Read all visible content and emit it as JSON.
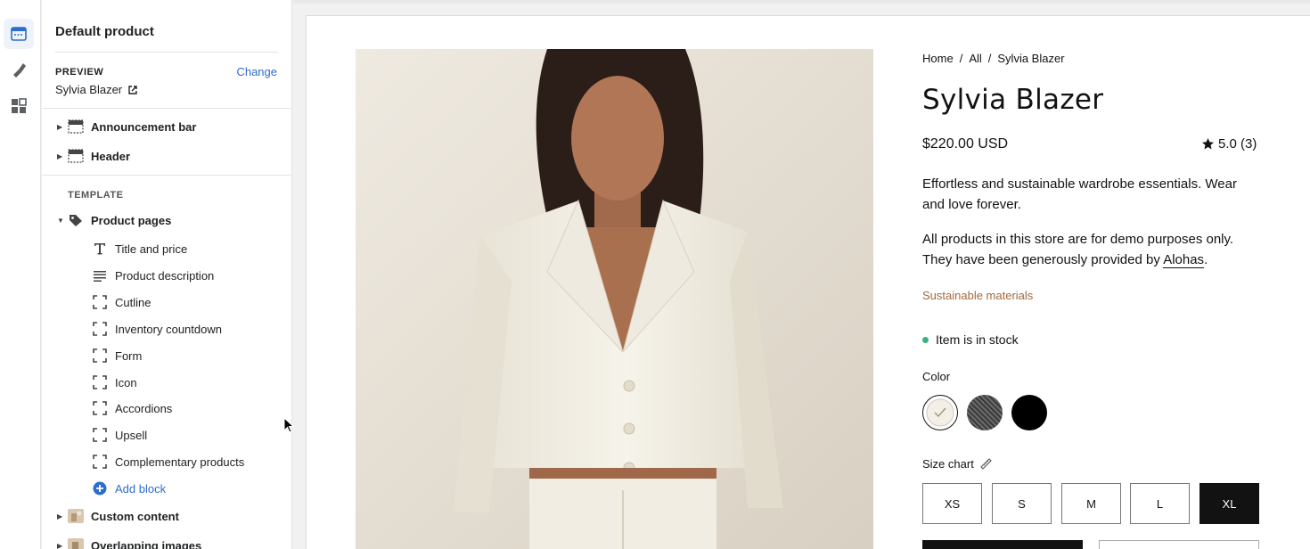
{
  "rail": {
    "items": [
      {
        "name": "sections",
        "active": true
      },
      {
        "name": "theme-settings",
        "active": false
      },
      {
        "name": "app-embeds",
        "active": false
      }
    ]
  },
  "sidebar": {
    "title": "Default product",
    "preview_label": "PREVIEW",
    "change_label": "Change",
    "preview_product": "Sylvia Blazer",
    "header_sections": [
      {
        "label": "Announcement bar",
        "icon": "section-icon"
      },
      {
        "label": "Header",
        "icon": "section-icon"
      }
    ],
    "template_label": "TEMPLATE",
    "product_pages_label": "Product pages",
    "blocks": [
      {
        "label": "Title and price",
        "icon": "text-icon"
      },
      {
        "label": "Product description",
        "icon": "paragraph-icon"
      },
      {
        "label": "Cutline",
        "icon": "app-block-icon"
      },
      {
        "label": "Inventory countdown",
        "icon": "app-block-icon"
      },
      {
        "label": "Form",
        "icon": "app-block-icon"
      },
      {
        "label": "Icon",
        "icon": "app-block-icon"
      },
      {
        "label": "Accordions",
        "icon": "app-block-icon"
      },
      {
        "label": "Upsell",
        "icon": "app-block-icon"
      },
      {
        "label": "Complementary products",
        "icon": "app-block-icon"
      }
    ],
    "add_block_label": "Add block",
    "other_sections": [
      {
        "label": "Custom content",
        "icon": "image-thumb-icon"
      },
      {
        "label": "Overlapping images",
        "icon": "image-thumb-icon"
      }
    ]
  },
  "product": {
    "breadcrumb": [
      "Home",
      "All",
      "Sylvia Blazer"
    ],
    "title": "Sylvia Blazer",
    "price": "$220.00 USD",
    "rating": "5.0 (3)",
    "description": "Effortless and sustainable wardrobe essentials. Wear and love forever.",
    "demo_note_prefix": "All products in this store are for demo purposes only. They have been generously provided by ",
    "demo_note_link": "Alohas",
    "demo_note_suffix": ".",
    "sustainable": "Sustainable materials",
    "stock": "Item is in stock",
    "color_label": "Color",
    "colors": [
      {
        "name": "cream",
        "hex": "#ffffff",
        "selected": true
      },
      {
        "name": "gray",
        "hex": "#555555",
        "selected": false
      },
      {
        "name": "black",
        "hex": "#000000",
        "selected": false
      }
    ],
    "size_label": "Size chart",
    "sizes": [
      "XS",
      "S",
      "M",
      "L",
      "XL"
    ],
    "selected_size": "XL"
  },
  "colors": {
    "accent_link": "#2c6ecb",
    "sustain_text": "#a0683e",
    "stock_dot": "#3cb17e",
    "selected_size_bg": "#121212"
  }
}
